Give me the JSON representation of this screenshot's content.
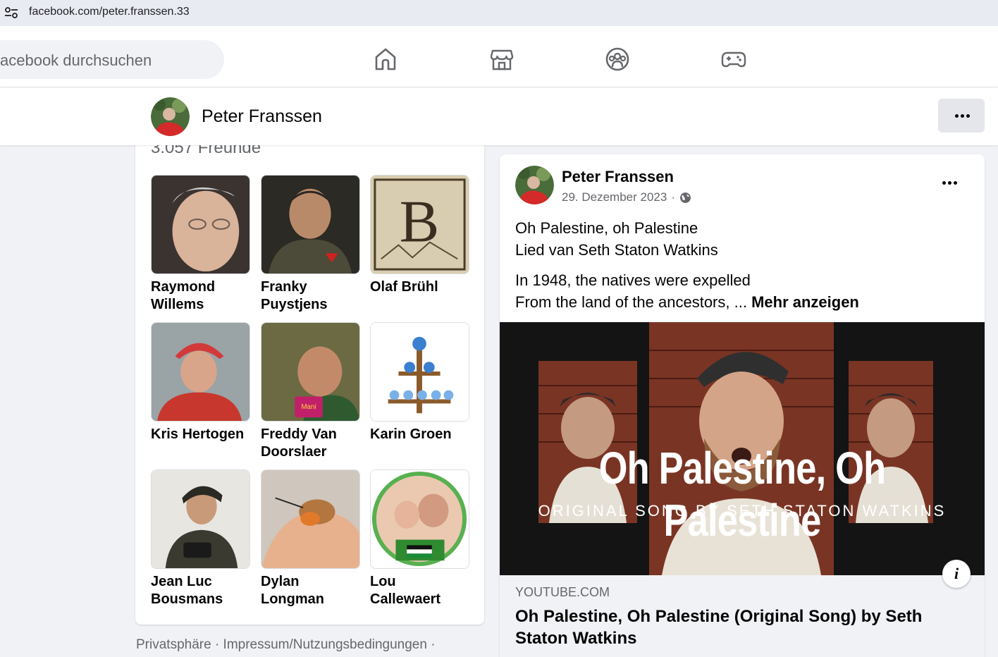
{
  "browser": {
    "url": "facebook.com/peter.franssen.33",
    "site_info_icon": "tune-icon"
  },
  "topbar": {
    "search_placeholder": "acebook durchsuchen",
    "nav": [
      {
        "name": "home",
        "icon": "home-icon"
      },
      {
        "name": "marketplace",
        "icon": "store-icon"
      },
      {
        "name": "groups",
        "icon": "groups-icon"
      },
      {
        "name": "gaming",
        "icon": "gamepad-icon"
      }
    ]
  },
  "profile": {
    "name": "Peter Franssen",
    "more_icon": "more-dots-icon"
  },
  "friends": {
    "count_label": "3.057 Freunde",
    "items": [
      {
        "name": "Raymond Willems"
      },
      {
        "name": "Franky Puystjens"
      },
      {
        "name": "Olaf Brühl"
      },
      {
        "name": "Kris Hertogen"
      },
      {
        "name": "Freddy Van Doorslaer"
      },
      {
        "name": "Karin Groen"
      },
      {
        "name": "Jean Luc Bousmans"
      },
      {
        "name": "Dylan Longman"
      },
      {
        "name": "Lou Callewaert"
      }
    ]
  },
  "footer": {
    "links": "Privatsphäre · Impressum/Nutzungsbedingungen ·"
  },
  "post": {
    "author": "Peter Franssen",
    "date": "29. Dezember 2023",
    "separator": "·",
    "audience_icon": "globe-icon",
    "line1": "Oh Palestine, oh Palestine",
    "line2": "Lied van Seth Staton Watkins",
    "line3": "In 1948, the natives were expelled",
    "line4": "From the land of the ancestors, ...",
    "see_more": "Mehr anzeigen",
    "thumbnail": {
      "title": "Oh Palestine, Oh Palestine",
      "subtitle": "ORIGINAL SONG BY SETH STATON WATKINS"
    },
    "info_label": "i",
    "link_domain": "YOUTUBE.COM",
    "link_title": "Oh Palestine, Oh Palestine (Original Song) by Seth Staton Watkins"
  }
}
